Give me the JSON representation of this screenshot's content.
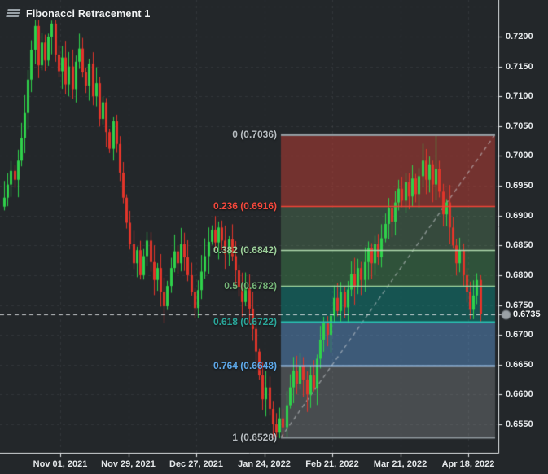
{
  "header": {
    "title": "Fibonacci Retracement 1"
  },
  "colors": {
    "background": "#23272a",
    "grid": "rgba(255,255,255,0.07)",
    "axis_line": "#e8ebed",
    "axis_text": "#e4e7e9",
    "bull_candle": "#2fd24b",
    "bear_candle": "#e2352a",
    "current_price_line": "rgba(233,236,238,0.85)",
    "price_marker_dot": "#9ba1a6",
    "diagonal_line": "rgba(205,210,214,0.55)"
  },
  "chart_data": {
    "type": "candlestick",
    "title": "Fibonacci Retracement 1",
    "grid": true,
    "x_tick_labels": [
      "Nov 01, 2021",
      "Nov 29, 2021",
      "Dec 27, 2021",
      "Jan 24, 2022",
      "Feb 21, 2022",
      "Mar 21, 2022",
      "Apr 18, 2022"
    ],
    "y_tick_labels": [
      "0.7200",
      "0.7150",
      "0.7100",
      "0.7050",
      "0.7000",
      "0.6950",
      "0.6900",
      "0.6850",
      "0.6800",
      "0.6750",
      "0.6700",
      "0.6650",
      "0.6600",
      "0.6550"
    ],
    "visible_price_range": [
      0.6502,
      0.7261
    ],
    "current_price": "0.6735",
    "closes": [
      0.693,
      0.6952,
      0.6975,
      0.696,
      0.6992,
      0.703,
      0.7072,
      0.7128,
      0.7178,
      0.7218,
      0.7152,
      0.719,
      0.716,
      0.72,
      0.7222,
      0.717,
      0.7142,
      0.7165,
      0.712,
      0.715,
      0.7112,
      0.7158,
      0.718,
      0.714,
      0.7118,
      0.7155,
      0.71,
      0.7122,
      0.7062,
      0.709,
      0.704,
      0.7012,
      0.7058,
      0.702,
      0.6972,
      0.693,
      0.6888,
      0.6852,
      0.682,
      0.6842,
      0.68,
      0.6832,
      0.6858,
      0.6822,
      0.6792,
      0.6812,
      0.6772,
      0.6748,
      0.6782,
      0.6812,
      0.684,
      0.682,
      0.6852,
      0.683,
      0.68,
      0.6772,
      0.6745,
      0.6775,
      0.6806,
      0.6832,
      0.6856,
      0.6876,
      0.6855,
      0.688,
      0.6858,
      0.6835,
      0.686,
      0.6832,
      0.6808,
      0.678,
      0.6755,
      0.6778,
      0.6744,
      0.671,
      0.6672,
      0.6632,
      0.6592,
      0.6612,
      0.6576,
      0.655,
      0.6536,
      0.656,
      0.6545,
      0.6582,
      0.6612,
      0.664,
      0.6618,
      0.6648,
      0.6625,
      0.66,
      0.6632,
      0.661,
      0.666,
      0.6692,
      0.6722,
      0.67,
      0.6732,
      0.6762,
      0.674,
      0.6772,
      0.6746,
      0.6776,
      0.6802,
      0.678,
      0.6812,
      0.6792,
      0.6822,
      0.6846,
      0.682,
      0.6852,
      0.683,
      0.6862,
      0.6886,
      0.6912,
      0.689,
      0.6922,
      0.6945,
      0.6925,
      0.6956,
      0.6932,
      0.6962,
      0.6936,
      0.6966,
      0.6992,
      0.696,
      0.6986,
      0.6952,
      0.6978,
      0.694,
      0.6902,
      0.6922,
      0.688,
      0.685,
      0.682,
      0.6842,
      0.68,
      0.6772,
      0.6742,
      0.6766,
      0.6792,
      0.6735
    ],
    "wick_overrides": [
      {
        "index": 14,
        "high": 0.7227
      },
      {
        "index": 80,
        "low": 0.6528
      },
      {
        "index": 127,
        "high": 0.7035
      }
    ],
    "fibonacci": {
      "name": "Fibonacci Retracement 1",
      "start_price": 0.6528,
      "end_price": 0.7036,
      "levels": [
        {
          "ratio": "0",
          "price": "0.7036",
          "label": "0 (0.7036)",
          "line_color": "#8e969b",
          "label_color": "#b6bcc0",
          "line_width": 3
        },
        {
          "ratio": "0.236",
          "price": "0.6916",
          "label": "0.236 (0.6916)",
          "line_color": "#f44336",
          "label_color": "#f4483c",
          "line_width": 1.5
        },
        {
          "ratio": "0.382",
          "price": "0.6842",
          "label": "0.382 (0.6842)",
          "line_color": "#aed9ac",
          "label_color": "#9ccf9a",
          "line_width": 1.5
        },
        {
          "ratio": "0.5",
          "price": "0.6782",
          "label": "0.5 (0.6782)",
          "line_color": "#9ed6a0",
          "label_color": "#74b377",
          "line_width": 1.5
        },
        {
          "ratio": "0.618",
          "price": "0.6722",
          "label": "0.618 (0.6722)",
          "line_color": "#2bbfb3",
          "label_color": "#2aa79b",
          "line_width": 2
        },
        {
          "ratio": "0.764",
          "price": "0.6648",
          "label": "0.764 (0.6648)",
          "line_color": "#a3c9ef",
          "label_color": "#5ea9ea",
          "line_width": 2
        },
        {
          "ratio": "1",
          "price": "0.6528",
          "label": "1 (0.6528)",
          "line_color": "#8e969b",
          "label_color": "#b6bcc0",
          "line_width": 2
        }
      ],
      "band_colors": [
        "rgba(195,62,52,0.50)",
        "rgba(118,190,126,0.24)",
        "rgba(72,170,92,0.33)",
        "rgba(0,165,152,0.36)",
        "rgba(96,156,220,0.44)",
        "rgba(172,177,182,0.27)"
      ]
    }
  }
}
